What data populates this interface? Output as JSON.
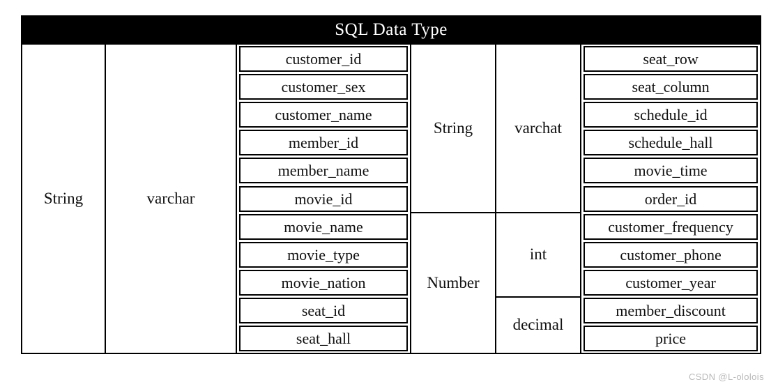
{
  "header": {
    "title": "SQL Data Type"
  },
  "table": {
    "columns": 6,
    "rows": 11,
    "left_group": {
      "type_label": "String",
      "sql_type_label": "varchar",
      "fields": [
        "customer_id",
        "customer_sex",
        "customer_name",
        "member_id",
        "member_name",
        "movie_id",
        "movie_name",
        "movie_type",
        "movie_nation",
        "seat_id",
        "seat_hall"
      ]
    },
    "right_groups": [
      {
        "type_label": "String",
        "type_rowspan": 6,
        "sql_type_label": "varchat",
        "sql_type_rowspan": 6,
        "fields": [
          "seat_row",
          "seat_column",
          "schedule_id",
          "schedule_hall",
          "movie_time",
          "order_id"
        ]
      },
      {
        "type_label": "Number",
        "type_rowspan": 5,
        "sql_types": [
          {
            "label": "int",
            "rowspan": 3,
            "fields": [
              "customer_frequency",
              "customer_phone",
              "customer_year"
            ]
          },
          {
            "label": "decimal",
            "rowspan": 2,
            "fields": [
              "member_discount",
              "price"
            ]
          }
        ]
      }
    ]
  },
  "watermark": {
    "text": "CSDN @L-ololois"
  },
  "colors": {
    "header_background": "#000000",
    "header_text": "#ffffff",
    "border": "#000000",
    "cell_text": "#111111",
    "page_background": "#ffffff",
    "watermark_text": "#b9b9b9"
  }
}
